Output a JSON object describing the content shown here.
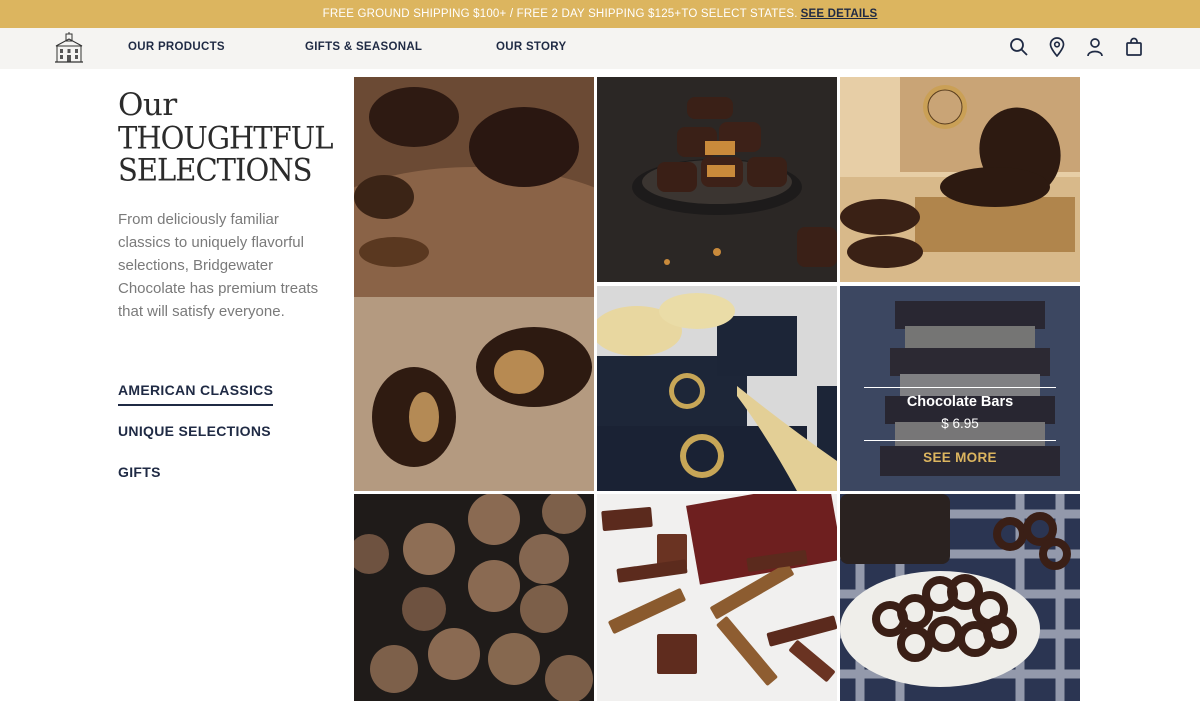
{
  "promo": {
    "text": "FREE GROUND SHIPPING $100+ / FREE 2 DAY SHIPPING $125+TO SELECT STATES.",
    "link": "SEE DETAILS"
  },
  "nav": {
    "products": "OUR PRODUCTS",
    "gifts": "GIFTS & SEASONAL",
    "story": "OUR STORY"
  },
  "icons": [
    "logo-icon",
    "search-icon",
    "location-pin-icon",
    "account-icon",
    "shopping-bag-icon"
  ],
  "headline": {
    "line1": "Our",
    "line2": "THOUGHTFUL",
    "line3": "SELECTIONS"
  },
  "intro": "From deliciously familiar classics to uniquely flavorful selections, Bridgewater Chocolate has premium treats that will satisfy everyone.",
  "categories": [
    "AMERICAN CLASSICS",
    "UNIQUE SELECTIONS",
    "GIFTS"
  ],
  "featured": {
    "title": "Chocolate Bars",
    "price": "$ 6.95",
    "cta": "SEE MORE"
  },
  "colors": {
    "promo_bg": "#dcb55f",
    "navy": "#1f2a44",
    "nav_bg": "#f5f4f2",
    "gold": "#dcb55f"
  }
}
